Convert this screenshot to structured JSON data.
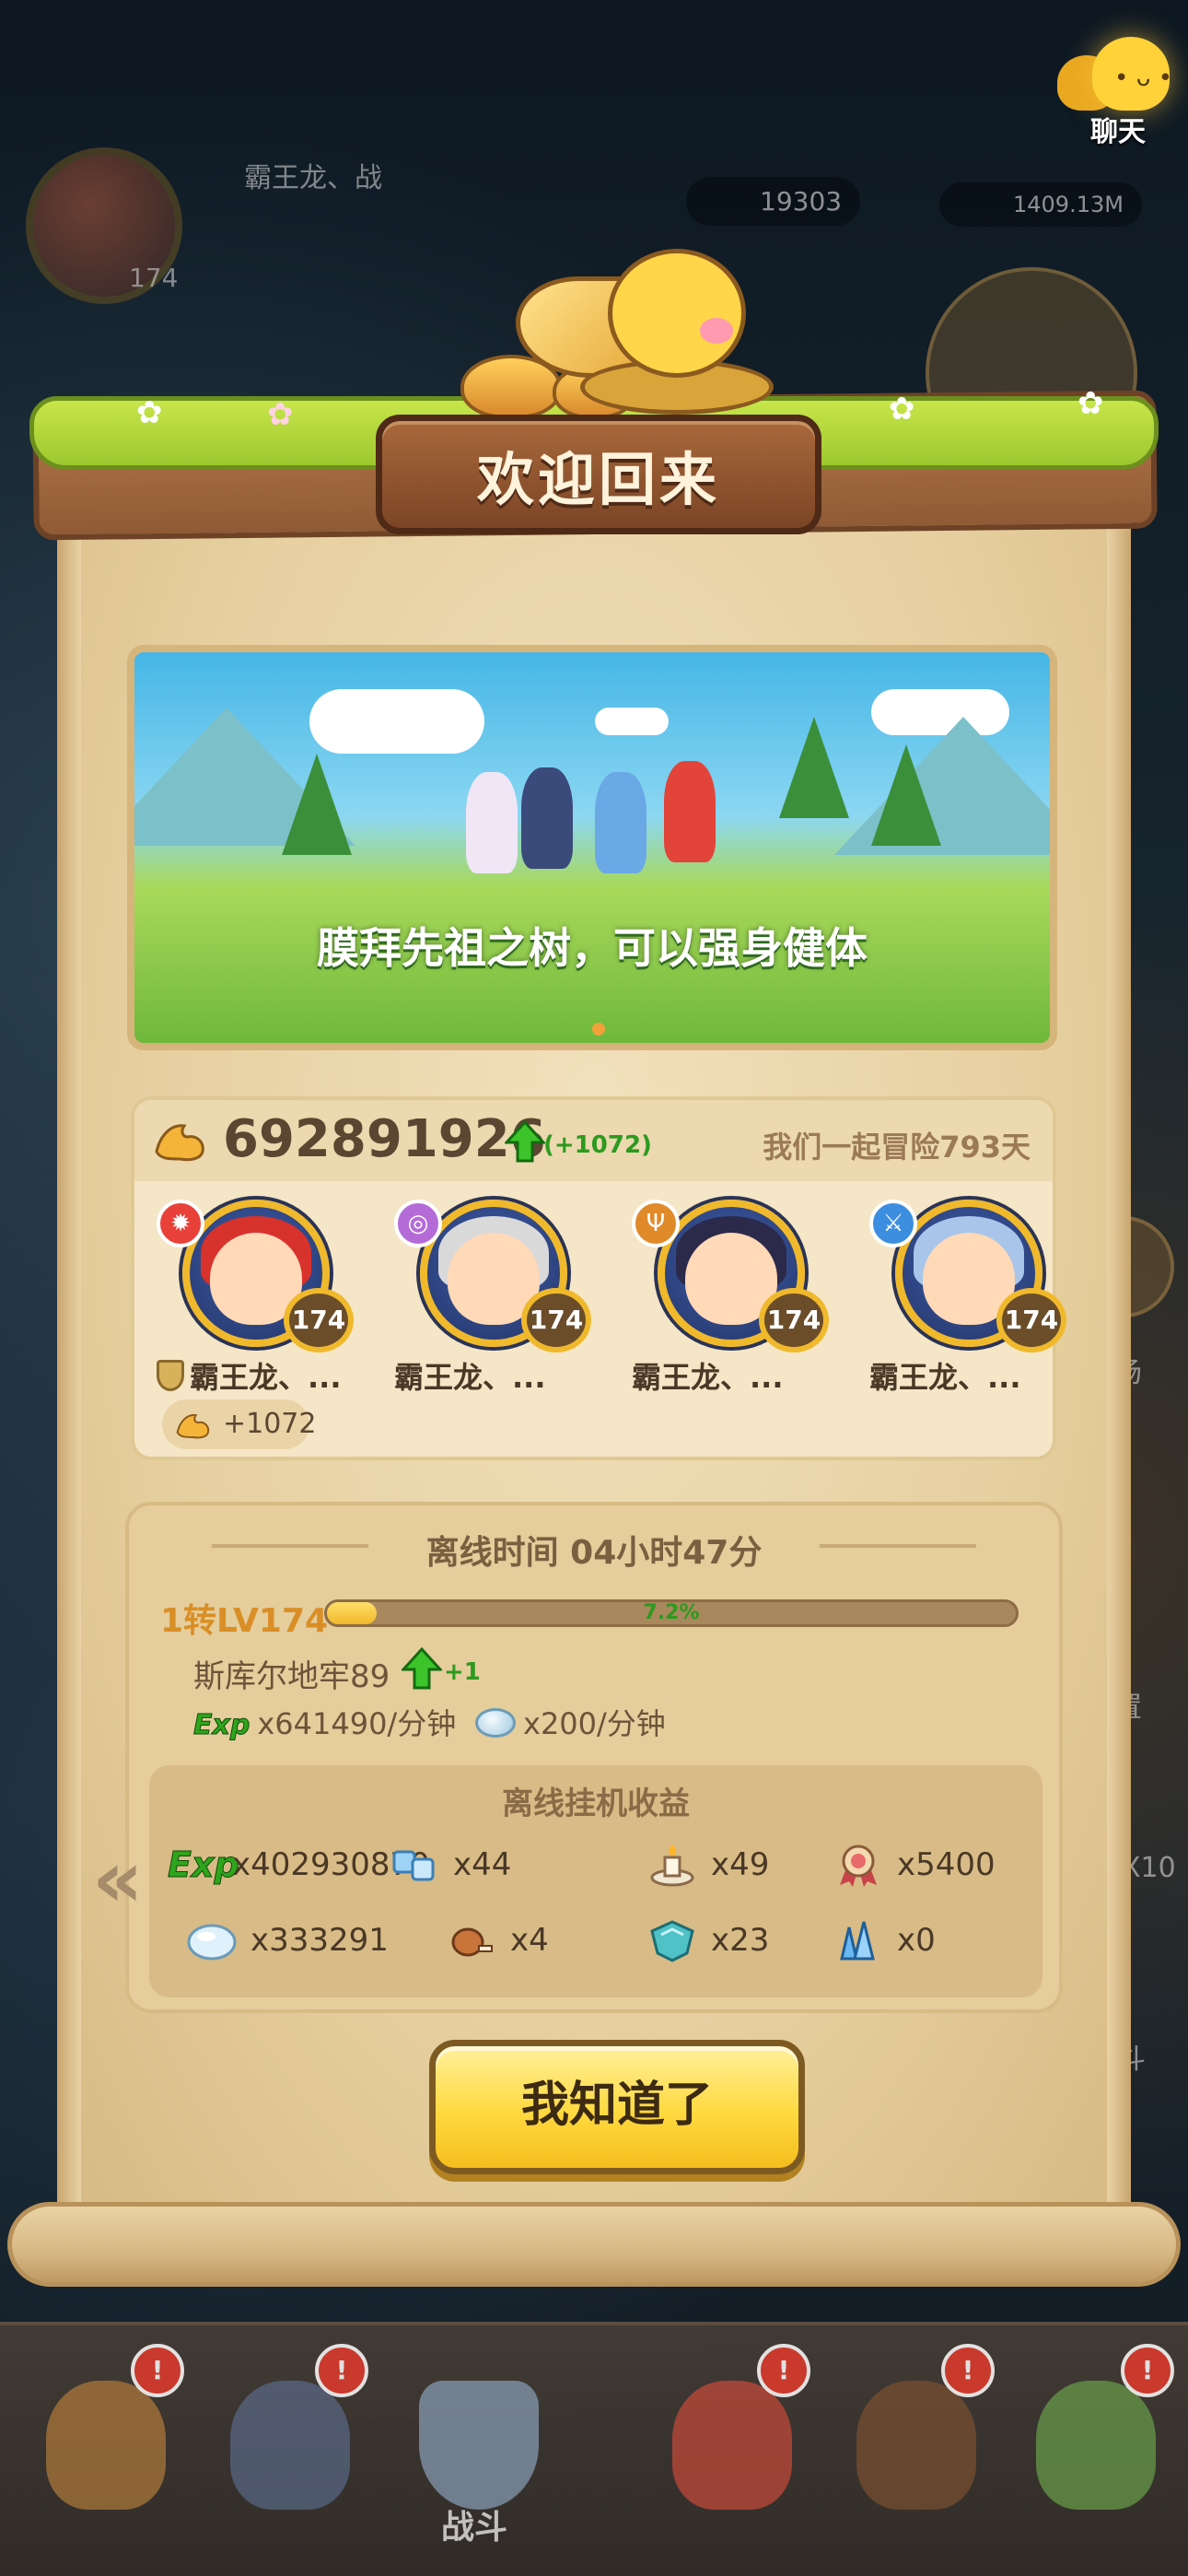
{
  "background": {
    "top_player_name": "霸王龙、战",
    "top_player_level": "174",
    "resource_1": "19303",
    "resource_2": "1409.13M",
    "side_label_1": "场",
    "side_label_2": "置",
    "side_label_3": "X10",
    "side_label_4": "斗"
  },
  "chat": {
    "label": "聊天"
  },
  "dialog": {
    "title": "欢迎回来",
    "banner_caption": "膜拜先祖之树，可以强身健体",
    "power": {
      "value": "692891926",
      "increase": "(+1072)",
      "adventure_days": "我们一起冒险793天",
      "bonus": "+1072"
    },
    "heroes": [
      {
        "name": "霸王龙、...",
        "level": "174",
        "element_icon": "fire-element-icon",
        "accent": "#e8413a",
        "hair": "#d8322c"
      },
      {
        "name": "霸王龙、...",
        "level": "174",
        "element_icon": "arcane-element-icon",
        "accent": "#b46bd8",
        "hair": "#d9d9d9"
      },
      {
        "name": "霸王龙、...",
        "level": "174",
        "element_icon": "trident-element-icon",
        "accent": "#e08a2a",
        "hair": "#2c2a4a"
      },
      {
        "name": "霸王龙、...",
        "level": "174",
        "element_icon": "sword-element-icon",
        "accent": "#3c8ee0",
        "hair": "#a9c6ea"
      }
    ],
    "offline": {
      "title": "离线时间 04小时47分",
      "rebirth_level": "1转LV174",
      "exp_percent_label": "7.2%",
      "exp_progress": 0.072,
      "dungeon": "斯库尔地牢89",
      "dungeon_increase": "+1",
      "exp_rate_tag": "Exp",
      "exp_rate": "x641490/分钟",
      "gem_rate": "x200/分钟",
      "rewards_title": "离线挂机收益",
      "rewards": [
        {
          "icon": "exp-icon",
          "text": "x402930870"
        },
        {
          "icon": "ice-crystal-cubes-icon",
          "text": "x44"
        },
        {
          "icon": "candle-icon",
          "text": "x49"
        },
        {
          "icon": "medal-icon",
          "text": "x5400"
        },
        {
          "icon": "gem-icon",
          "text": "x333291"
        },
        {
          "icon": "meat-icon",
          "text": "x4"
        },
        {
          "icon": "shield-stone-icon",
          "text": "x23"
        },
        {
          "icon": "blue-crystal-icon",
          "text": "x0"
        }
      ]
    },
    "ok_button": "我知道了"
  },
  "bottom_nav": {
    "items": [
      {
        "label": "",
        "badge": "!"
      },
      {
        "label": "",
        "badge": "!"
      },
      {
        "label": "战斗",
        "badge": ""
      },
      {
        "label": "",
        "badge": "!"
      },
      {
        "label": "",
        "badge": "!"
      },
      {
        "label": "",
        "badge": "!"
      }
    ]
  },
  "colors": {
    "scroll_parchment": "#e6cf9f",
    "title_plate": "#7b4526",
    "button_yellow": "#ffd93f",
    "increase_green": "#2c9a1e",
    "level_gold": "#f0b92c"
  }
}
